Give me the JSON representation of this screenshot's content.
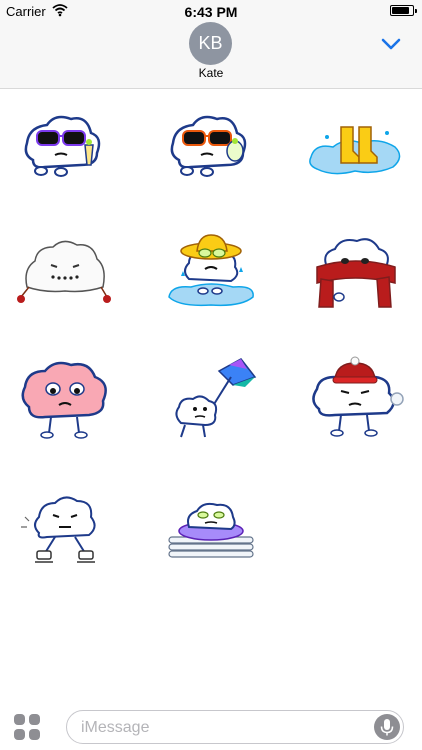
{
  "status_bar": {
    "carrier": "Carrier",
    "time": "6:43 PM",
    "battery_level": 0.85
  },
  "conversation": {
    "avatar_initials": "KB",
    "contact_name": "Kate"
  },
  "stickers": [
    {
      "icon": "cloud-sunglasses-drink-sticker"
    },
    {
      "icon": "cloud-orange-sunglasses-drink-sticker"
    },
    {
      "icon": "yellow-boots-puddle-sticker"
    },
    {
      "icon": "melting-snowman-sticker"
    },
    {
      "icon": "cloud-yellow-hat-puddle-sticker"
    },
    {
      "icon": "cloud-red-scarf-sticker"
    },
    {
      "icon": "pink-cloud-sticker"
    },
    {
      "icon": "cloud-umbrella-sticker"
    },
    {
      "icon": "cloud-red-hat-snowball-sticker"
    },
    {
      "icon": "cloud-skating-sticker"
    },
    {
      "icon": "cloud-swim-ring-sticker"
    }
  ],
  "input": {
    "placeholder": "iMessage"
  },
  "colors": {
    "accent": "#1a73e8",
    "cloud_outline": "#1e3a8a",
    "header_bg": "#f7f7f7"
  }
}
